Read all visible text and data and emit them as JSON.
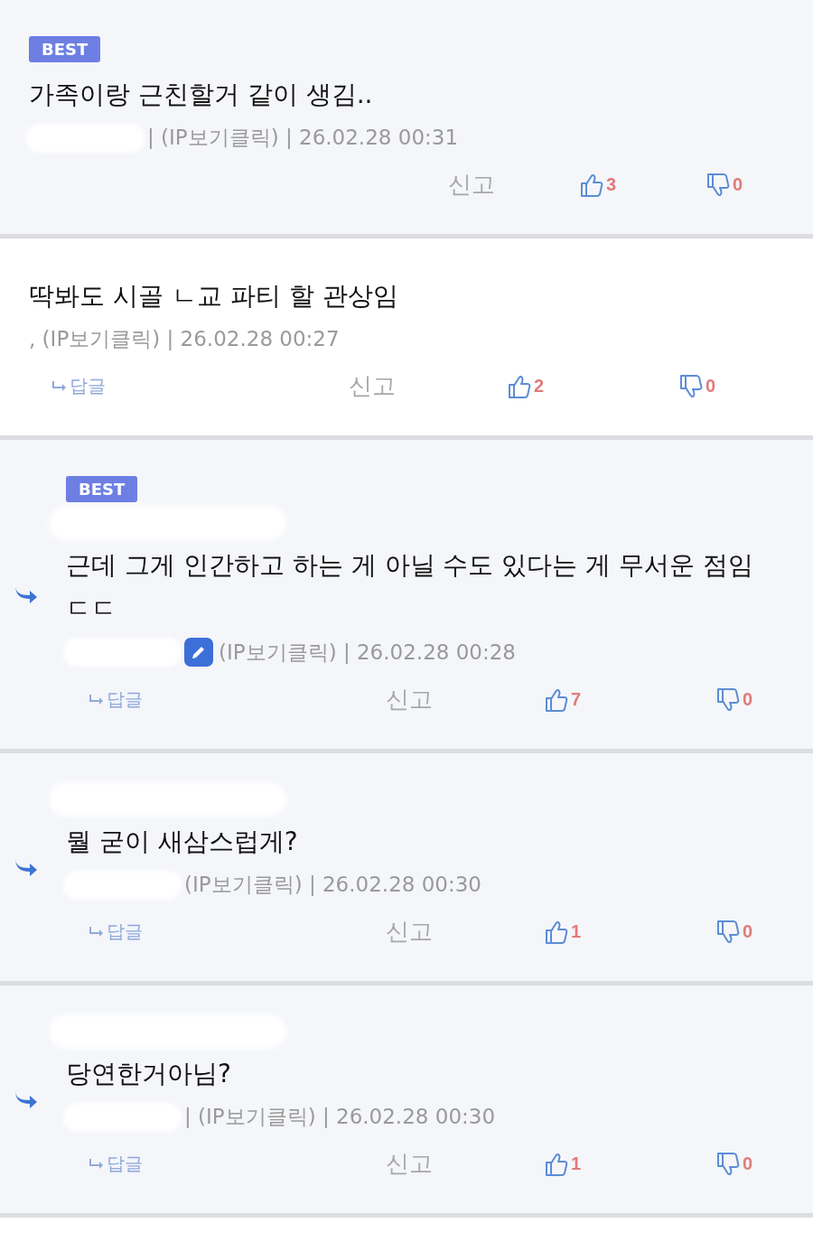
{
  "comments": [
    {
      "kind": "comment",
      "badge": "BEST",
      "text": "가족이랑 근친할거 같이 생김..",
      "writer": false,
      "meta": "| (IP보기클릭) | 26.02.28 00:31",
      "report": "신고",
      "likes": "3",
      "dislikes": "0"
    },
    {
      "kind": "comment",
      "text": "딱봐도 시골 ㄴ교 파티 할 관상임",
      "writer": false,
      "meta": ", (IP보기클릭) | 26.02.28 00:27",
      "reply_button": "답글",
      "report": "신고",
      "likes": "2",
      "dislikes": "0"
    },
    {
      "kind": "reply",
      "badge": "BEST",
      "text": "근데 그게 인간하고 하는 게 아닐 수도 있다는 게 무서운 점임 ㄷㄷ",
      "writer": true,
      "meta": "(IP보기클릭) | 26.02.28 00:28",
      "reply_button": "답글",
      "report": "신고",
      "likes": "7",
      "dislikes": "0"
    },
    {
      "kind": "reply",
      "text": "뭘 굳이 새삼스럽게?",
      "writer": false,
      "meta": "(IP보기클릭) | 26.02.28 00:30",
      "reply_button": "답글",
      "report": "신고",
      "likes": "1",
      "dislikes": "0"
    },
    {
      "kind": "reply",
      "text": "당연한거아님?",
      "writer": false,
      "meta": "| (IP보기클릭) | 26.02.28 00:30",
      "reply_button": "답글",
      "report": "신고",
      "likes": "1",
      "dislikes": "0"
    }
  ]
}
